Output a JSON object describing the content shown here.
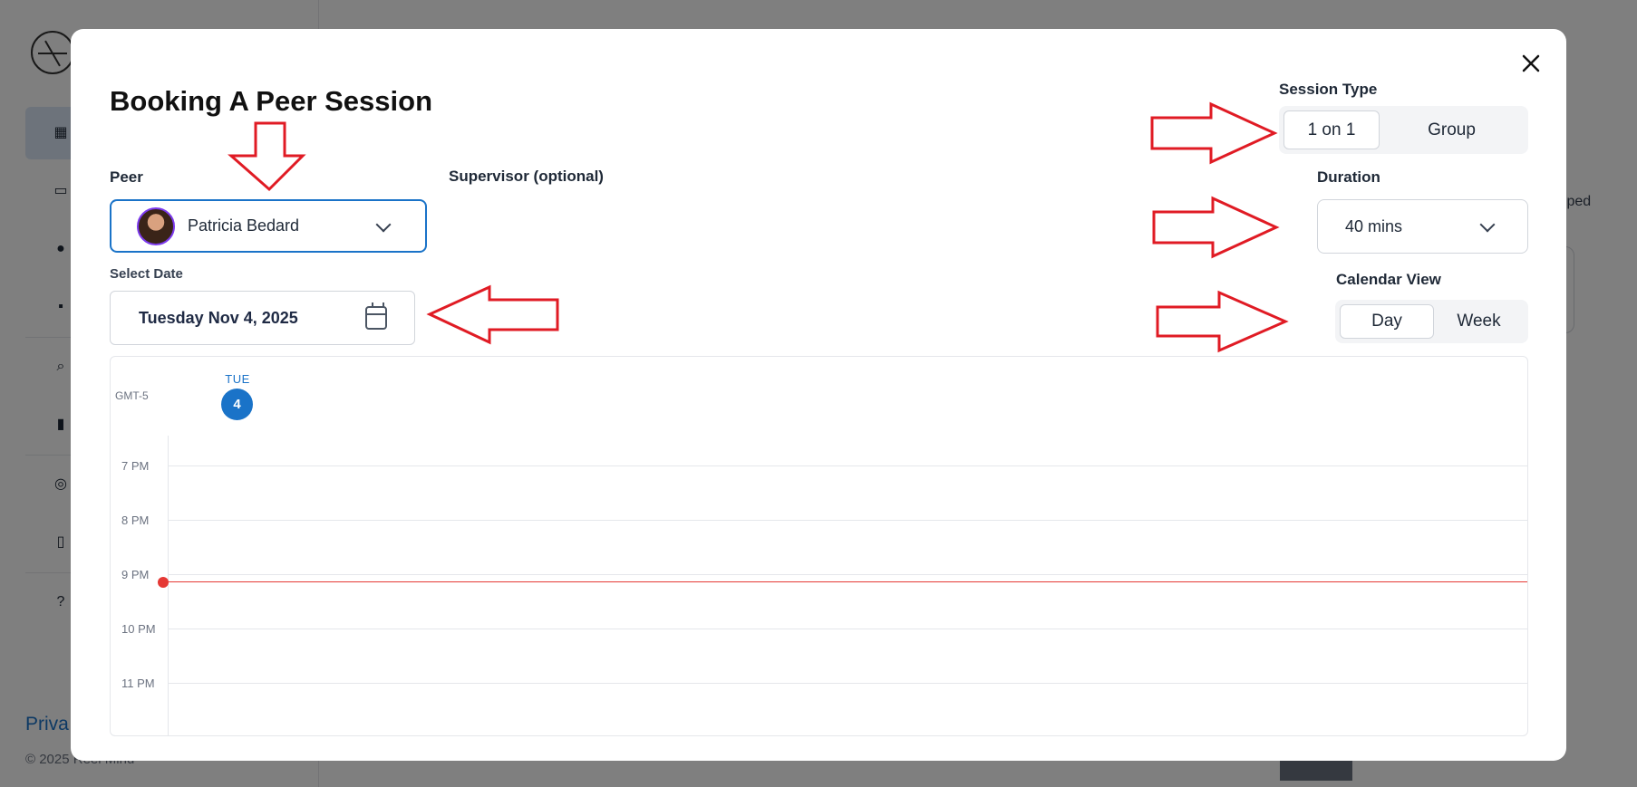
{
  "background": {
    "footer_link": "Priva",
    "footer_copy": "© 2025 Reel Mind",
    "right_text": "elped"
  },
  "modal": {
    "title": "Booking A Peer Session",
    "peer": {
      "label": "Peer",
      "selected": "Patricia Bedard"
    },
    "supervisor": {
      "label": "Supervisor (optional)"
    },
    "date": {
      "label": "Select Date",
      "value": "Tuesday Nov 4, 2025"
    },
    "session_type": {
      "label": "Session Type",
      "options": [
        "1 on 1",
        "Group"
      ],
      "selected": "1 on 1"
    },
    "duration": {
      "label": "Duration",
      "value": "40 mins"
    },
    "calendar_view": {
      "label": "Calendar View",
      "options": [
        "Day",
        "Week"
      ],
      "selected": "Day"
    },
    "calendar": {
      "timezone": "GMT-5",
      "day_abbr": "TUE",
      "day_num": "4",
      "hours": [
        "7 PM",
        "8 PM",
        "9 PM",
        "10 PM",
        "11 PM"
      ]
    }
  },
  "icons": [
    "close-icon",
    "chevron-down-icon",
    "calendar-icon",
    "avatar"
  ],
  "colors": {
    "accent": "#1a73c8",
    "now_indicator": "#e53935",
    "annotation_arrow": "#e01b24"
  }
}
